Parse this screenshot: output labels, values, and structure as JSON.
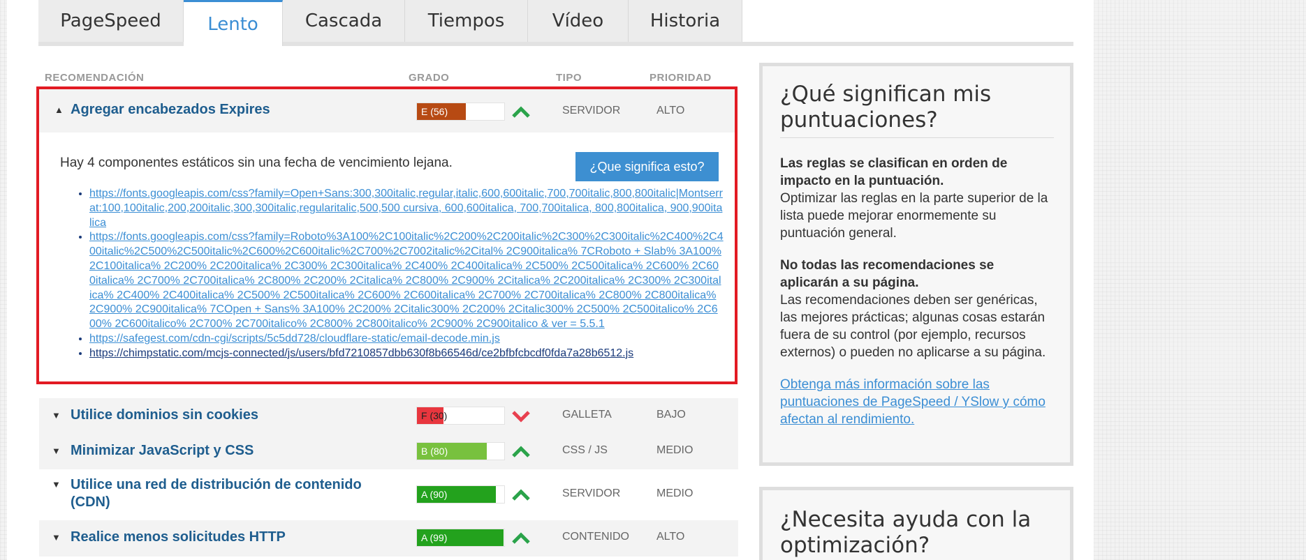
{
  "tabs": [
    {
      "label": "PageSpeed"
    },
    {
      "label": "Lento"
    },
    {
      "label": "Cascada"
    },
    {
      "label": "Tiempos"
    },
    {
      "label": "Vídeo"
    },
    {
      "label": "Historia"
    }
  ],
  "table_headers": {
    "recommendation": "RECOMENDACIÓN",
    "grade": "GRADO",
    "type": "TIPO",
    "priority": "PRIORIDAD"
  },
  "expanded_rule": {
    "title": "Agregar encabezados Expires",
    "grade_label": "E (56)",
    "grade_value": 56,
    "grade_color": "#b74a13",
    "trend": "up",
    "type": "SERVIDOR",
    "priority": "ALTO",
    "description": "Hay 4 componentes estáticos sin una fecha de vencimiento lejana.",
    "help_button": "¿Que significa esto?",
    "links": [
      "https://fonts.googleapis.com/css?family=Open+Sans:300,300italic,regular,italic,600,600italic,700,700italic,800,800italic|Montserrat:100,100italic,200,200italic,300,300italic,regularitalic,500,500 cursiva, 600,600italica, 700,700italica, 800,800italica, 900,900italica",
      "https://fonts.googleapis.com/css?family=Roboto%3A100%2C100italic%2C200%2C200italic%2C300%2C300italic%2C400%2C400italic%2C500%2C500italic%2C600%2C600italic%2C700%2C7002italic%2Cital% 2C900italica% 7CRoboto + Slab% 3A100% 2C100italica% 2C200% 2C200italica% 2C300% 2C300italica% 2C400% 2C400italica% 2C500% 2C500italica% 2C600% 2C600italica% 2C700% 2C700italica% 2C800% 2C200% 2Citalica% 2C800% 2C900% 2Citalica% 2C200italica% 2C300% 2C300italica% 2C400% 2C400italica% 2C500% 2C500italica% 2C600% 2C600italica% 2C700% 2C700italica% 2C800% 2C800italica% 2C900% 2C900italica% 7COpen + Sans% 3A100% 2C200% 2Citalic300% 2C200% 2Citalic300% 2C500% 2C500italico% 2C600% 2C600italico% 2C700% 2C700italico% 2C800% 2C800italico% 2C900% 2C900italico & ver = 5.5.1",
      "https://safegest.com/cdn-cgi/scripts/5c5dd728/cloudflare-static/email-decode.min.js",
      "https://chimpstatic.com/mcjs-connected/js/users/bfd7210857dbb630f8b66546d/ce2bfbfcbcdf0fda7a28b6512.js"
    ]
  },
  "rules": [
    {
      "title": "Utilice dominios sin cookies",
      "grade_label": "F (30)",
      "grade_value": 30,
      "grade_color": "#e8363e",
      "label_dark": true,
      "trend": "down",
      "type": "GALLETA",
      "priority": "BAJO"
    },
    {
      "title": "Minimizar JavaScript y CSS",
      "grade_label": "B (80)",
      "grade_value": 80,
      "grade_color": "#78c13e",
      "label_dark": false,
      "trend": "up",
      "type": "CSS / JS",
      "priority": "MEDIO"
    },
    {
      "title": "Utilice una red de distribución de contenido (CDN)",
      "grade_label": "A (90)",
      "grade_value": 90,
      "grade_color": "#23a21d",
      "label_dark": false,
      "trend": "up",
      "type": "SERVIDOR",
      "priority": "MEDIO"
    },
    {
      "title": "Realice menos solicitudes HTTP",
      "grade_label": "A (99)",
      "grade_value": 99,
      "grade_color": "#23a21d",
      "label_dark": false,
      "trend": "up",
      "type": "CONTENIDO",
      "priority": "ALTO"
    }
  ],
  "sidebar": {
    "scores_box": {
      "heading": "¿Qué significan mis puntuaciones?",
      "p1_bold": "Las reglas se clasifican en orden de impacto en la puntuación.",
      "p1_text": "Optimizar las reglas en la parte superior de la lista puede mejorar enormemente su puntuación general.",
      "p2_bold": "No todas las recomendaciones se aplicarán a su página.",
      "p2_text": "Las recomendaciones deben ser genéricas, las mejores prácticas; algunas cosas estarán fuera de su control (por ejemplo, recursos externos) o pueden no aplicarse a su página.",
      "link": "Obtenga más información sobre las puntuaciones de PageSpeed / YSlow y cómo afectan al rendimiento."
    },
    "help_box": {
      "heading": "¿Necesita ayuda con la optimización?"
    }
  },
  "colors": {
    "accent": "#3b8ed4",
    "rule_title": "#1e5d8e",
    "highlight_border": "#e21b23",
    "trend_up": "#2aa34a",
    "trend_down": "#e8404f"
  }
}
